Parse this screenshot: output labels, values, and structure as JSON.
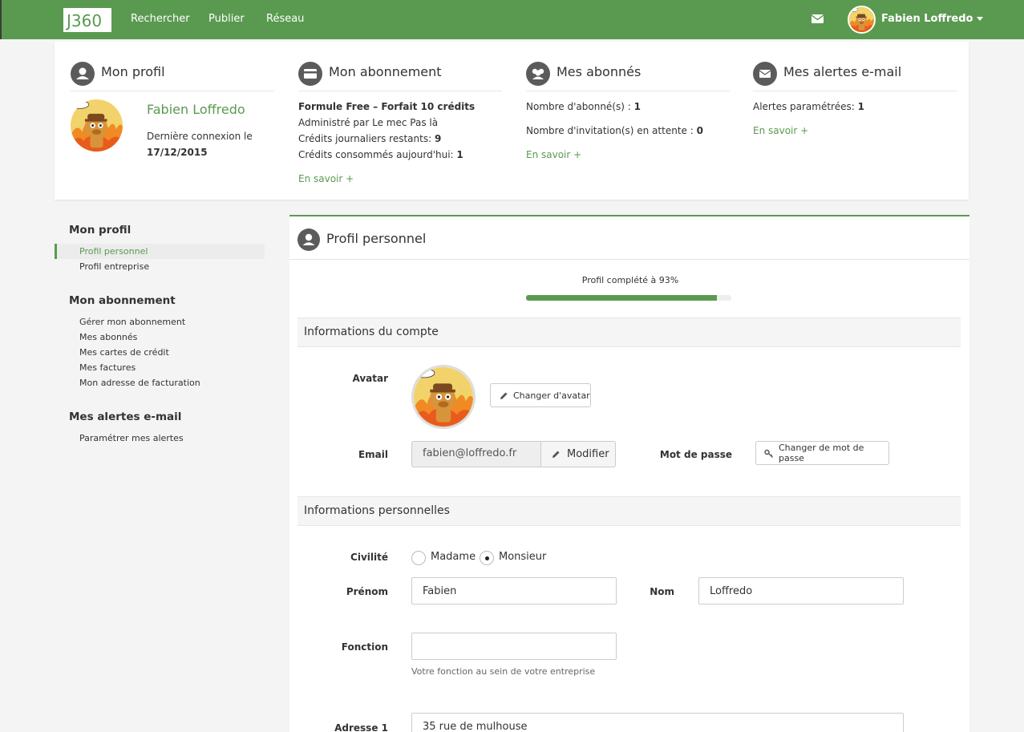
{
  "brand": {
    "logo_text": "J360",
    "accent_color": "#5a9a50"
  },
  "nav": {
    "links": [
      "Rechercher",
      "Publier",
      "Réseau"
    ],
    "mail_icon": "envelope-icon",
    "user_name": "Fabien Loffredo"
  },
  "summary": {
    "profile": {
      "title": "Mon profil",
      "name": "Fabien Loffredo",
      "last_login_label": "Dernière connexion le",
      "last_login_date": "17/12/2015"
    },
    "subscription": {
      "title": "Mon abonnement",
      "plan": "Formule Free – Forfait 10 crédits",
      "admin": "Administré par Le mec Pas là",
      "credits_left_label": "Crédits journaliers restants:",
      "credits_left": "9",
      "credits_used_label": "Crédits consommés aujourd'hui:",
      "credits_used": "1",
      "more": "En savoir +"
    },
    "subscribers": {
      "title": "Mes abonnés",
      "count_label": "Nombre d'abonné(s) :",
      "count": "1",
      "pending_label": "Nombre d'invitation(s) en attente :",
      "pending": "0",
      "more": "En savoir +"
    },
    "alerts": {
      "title": "Mes alertes e-mail",
      "configured_label": "Alertes paramétrées:",
      "configured": "1",
      "more": "En savoir +"
    }
  },
  "sidebar": {
    "sections": [
      {
        "title": "Mon profil",
        "items": [
          "Profil personnel",
          "Profil entreprise"
        ]
      },
      {
        "title": "Mon abonnement",
        "items": [
          "Gérer mon abonnement",
          "Mes abonnés",
          "Mes cartes de crédit",
          "Mes factures",
          "Mon adresse de facturation"
        ]
      },
      {
        "title": "Mes alertes e-mail",
        "items": [
          "Paramétrer mes alertes"
        ]
      }
    ],
    "active_item": "Profil personnel"
  },
  "main": {
    "title": "Profil personnel",
    "progress_label": "Profil complété à 93%",
    "progress_value": 0.93,
    "account_section": "Informations du compte",
    "avatar_label": "Avatar",
    "change_avatar": "Changer d'avatar",
    "email_label": "Email",
    "email_value": "fabien@loffredo.fr",
    "modify": "Modifier",
    "password_label": "Mot de passe",
    "change_password": "Changer de mot de passe",
    "personal_section": "Informations personnelles",
    "civility_label": "Civilité",
    "civility_options": [
      "Madame",
      "Monsieur"
    ],
    "civility_selected": "Monsieur",
    "firstname_label": "Prénom",
    "firstname_value": "Fabien",
    "lastname_label": "Nom",
    "lastname_value": "Loffredo",
    "function_label": "Fonction",
    "function_value": "",
    "function_help": "Votre fonction au sein de votre entreprise",
    "address1_label": "Adresse 1",
    "address1_value": "35 rue de mulhouse"
  }
}
